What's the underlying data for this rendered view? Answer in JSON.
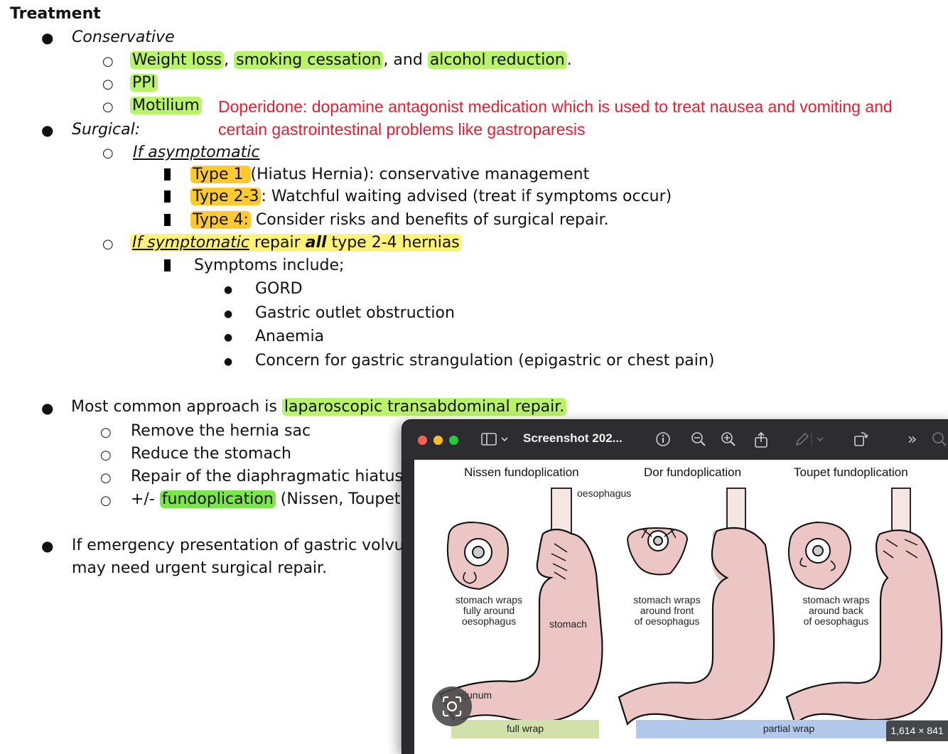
{
  "doc": {
    "heading": "Treatment",
    "conservative": {
      "label": "Conservative",
      "item1": {
        "a": "Weight loss",
        "sep1": ", ",
        "b": "smoking cessation",
        "sep2": ", and ",
        "c": "alcohol reduction",
        "end": "."
      },
      "item2": "PPI",
      "item3": "Motilium",
      "note_line1": "Doperidone: dopamine antagonist medication which is used to treat nausea and vomiting and",
      "note_line2": "certain gastrointestinal problems like gastroparesis"
    },
    "surgical": {
      "label": "Surgical:",
      "asym_label": "If asymptomatic",
      "type1": {
        "tag": "Type 1 ",
        "text": "(Hiatus Hernia): conservative management"
      },
      "type23": {
        "tag": "Type 2-3",
        "text": ": Watchful waiting advised (treat if symptoms occur)"
      },
      "type4": {
        "tag": "Type 4:",
        "text": " Consider risks and benefits of surgical repair."
      },
      "sym": {
        "a": "If symptomatic",
        "b": " repair ",
        "c": "all",
        "d": " type 2-4 hernias"
      },
      "symptoms_intro": "Symptoms include;",
      "symptoms": [
        "GORD",
        "Gastric outlet obstruction",
        "Anaemia",
        "Concern for gastric strangulation (epigastric or chest pain)"
      ]
    },
    "approach": {
      "pre": "Most common approach is ",
      "hl": "laparoscopic transabdominal repair.",
      "steps": [
        "Remove the hernia sac",
        "Reduce the stomach",
        "Repair of the diaphragmatic hiatus."
      ],
      "fundo": {
        "pre": "+/- ",
        "hl": "fundoplication",
        "post": " (Nissen, Toupet, D"
      }
    },
    "emergency": {
      "line1": "If emergency presentation of gastric volvulu",
      "line2": "may need urgent surgical repair."
    }
  },
  "viewer": {
    "title": "Screenshot 202...",
    "dimensions": "1,614 × 841",
    "figure": {
      "titles": [
        "Nissen fundoplication",
        "Dor fundoplication",
        "Toupet fundoplication"
      ],
      "oesophagus": "oesophagus",
      "stomach": "stomach",
      "jejunum": "jejunum",
      "captions": [
        [
          "stomach wraps",
          "fully around",
          "oesophagus"
        ],
        [
          "stomach wraps",
          "around front",
          "of oesophagus"
        ],
        [
          "stomach wraps",
          "around back",
          "of oesophagus"
        ]
      ],
      "full_wrap": "full wrap",
      "partial_wrap": "partial wrap"
    }
  },
  "colors": {
    "green_hl": "#b9f26b",
    "bright_green_hl": "#7be64a",
    "yellow_hl": "#ffc933",
    "pale_yellow_hl": "#fff27a",
    "note_red": "#e02034",
    "stomach_fill": "#ebc6c4"
  }
}
